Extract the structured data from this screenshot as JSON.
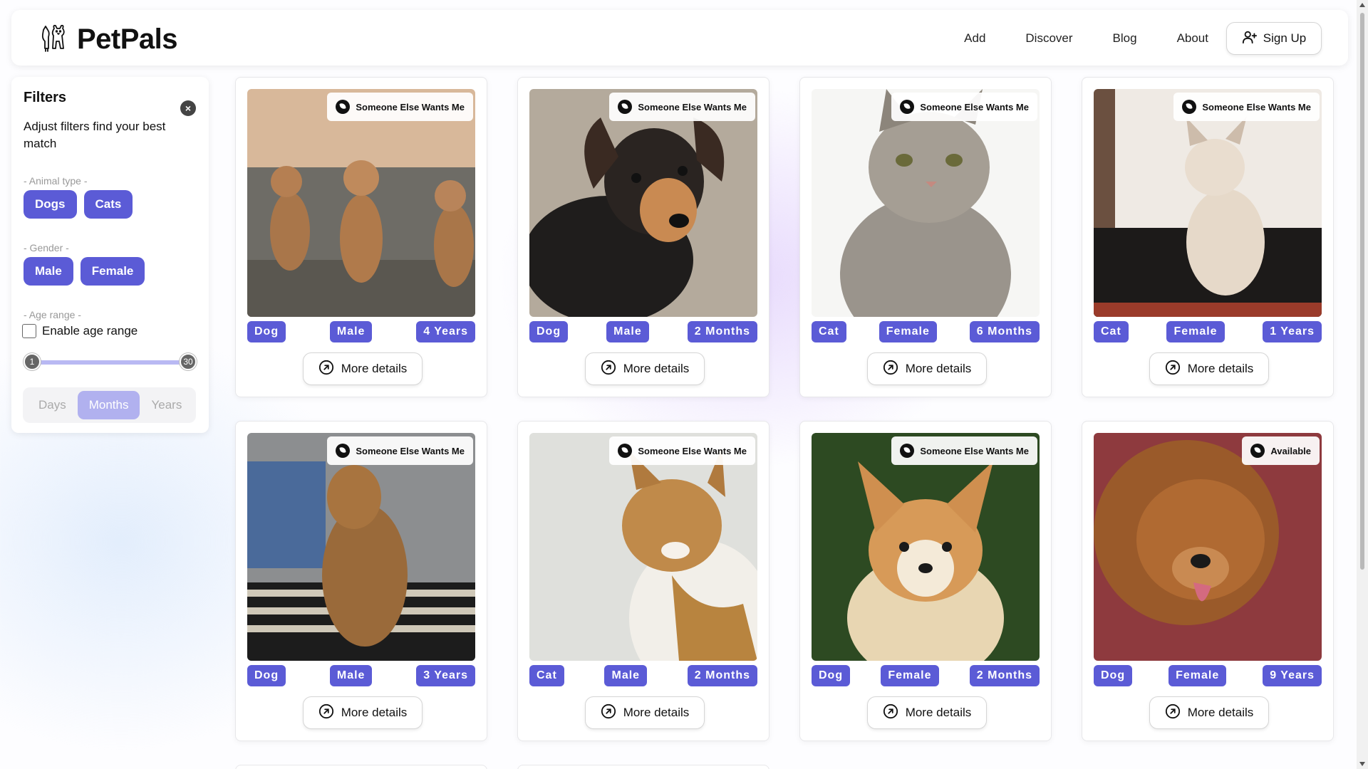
{
  "brand": {
    "name": "PetPals",
    "logo_icon": "dog-and-cat-icon"
  },
  "nav": {
    "items": [
      {
        "label": "Add"
      },
      {
        "label": "Discover"
      },
      {
        "label": "Blog"
      },
      {
        "label": "About"
      }
    ],
    "signup_label": "Sign Up",
    "signup_icon": "user-plus-icon"
  },
  "filters": {
    "title": "Filters",
    "subtitle": "Adjust filters find your best match",
    "animal_type": {
      "label": "- Animal type -",
      "options": [
        "Dogs",
        "Cats"
      ]
    },
    "gender": {
      "label": "- Gender -",
      "options": [
        "Male",
        "Female"
      ]
    },
    "age_range": {
      "label": "- Age range -",
      "toggle_label": "Enable age range",
      "enabled": false,
      "min": "1",
      "max": "30",
      "units": [
        "Days",
        "Months",
        "Years"
      ],
      "selected_unit": "Months"
    }
  },
  "card_button_label": "More details",
  "pets": [
    {
      "status": "Someone Else Wants Me",
      "type": "Dog",
      "gender": "Male",
      "age": "4 Years"
    },
    {
      "status": "Someone Else Wants Me",
      "type": "Dog",
      "gender": "Male",
      "age": "2 Months"
    },
    {
      "status": "Someone Else Wants Me",
      "type": "Cat",
      "gender": "Female",
      "age": "6 Months"
    },
    {
      "status": "Someone Else Wants Me",
      "type": "Cat",
      "gender": "Female",
      "age": "1 Years"
    },
    {
      "status": "Someone Else Wants Me",
      "type": "Dog",
      "gender": "Male",
      "age": "3 Years"
    },
    {
      "status": "Someone Else Wants Me",
      "type": "Cat",
      "gender": "Male",
      "age": "2 Months"
    },
    {
      "status": "Someone Else Wants Me",
      "type": "Dog",
      "gender": "Female",
      "age": "2 Months"
    },
    {
      "status": "Available",
      "type": "Dog",
      "gender": "Female",
      "age": "9 Years"
    }
  ],
  "colors": {
    "accent": "#5b5bd6",
    "accent_light": "#b1b1ef"
  }
}
